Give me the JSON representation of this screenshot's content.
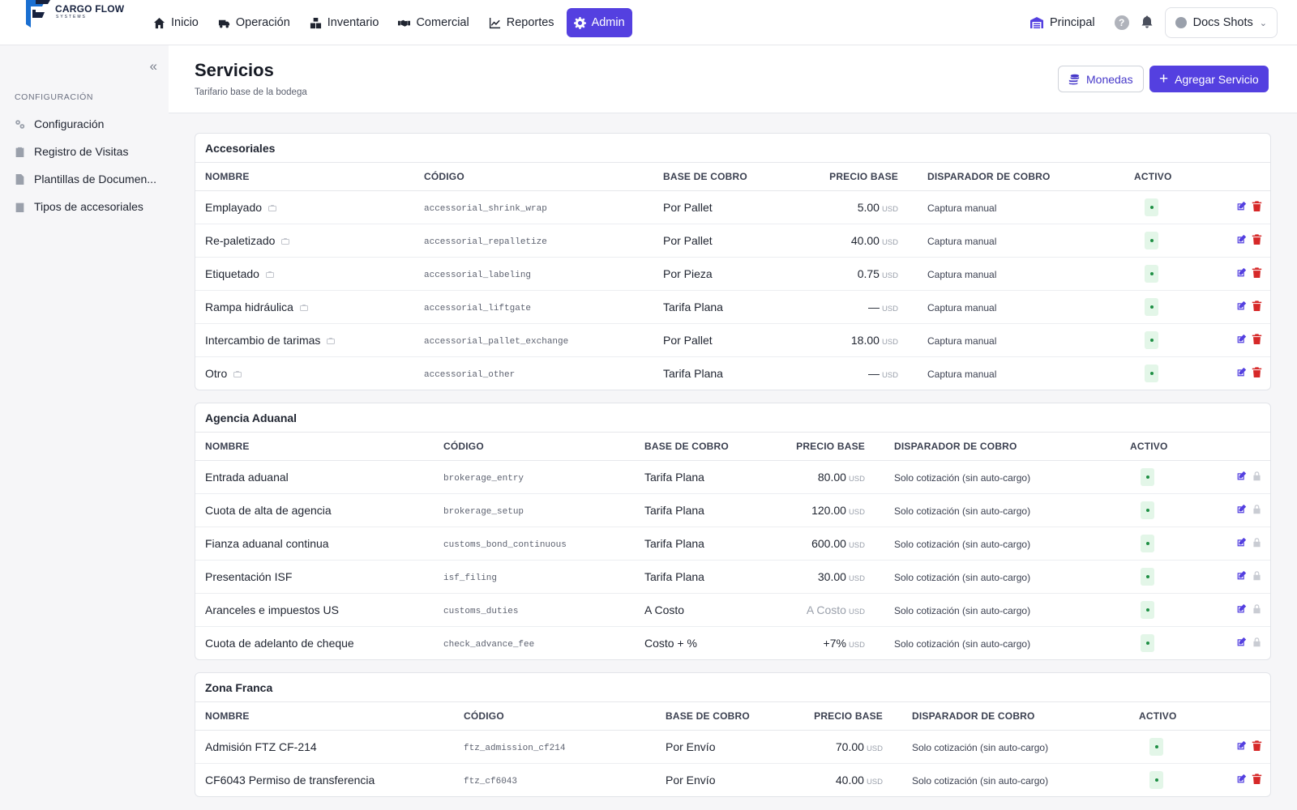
{
  "brand": {
    "name": "CARGO FLOW",
    "sub": "SYSTEMS"
  },
  "nav": [
    {
      "label": "Inicio",
      "icon": "home-icon",
      "active": false
    },
    {
      "label": "Operación",
      "icon": "truck-icon",
      "active": false
    },
    {
      "label": "Inventario",
      "icon": "boxes-icon",
      "active": false
    },
    {
      "label": "Comercial",
      "icon": "handshake-icon",
      "active": false
    },
    {
      "label": "Reportes",
      "icon": "chart-line-icon",
      "active": false
    },
    {
      "label": "Admin",
      "icon": "gear-icon",
      "active": true
    }
  ],
  "topbar": {
    "branch": "Principal",
    "help": "?",
    "user": "Docs Shots"
  },
  "sidebar": {
    "collapse_icon": "«",
    "heading": "CONFIGURACIÓN",
    "items": [
      {
        "label": "Configuración",
        "icon": "gears-icon"
      },
      {
        "label": "Registro de Visitas",
        "icon": "clipboard-icon"
      },
      {
        "label": "Plantillas de Documen...",
        "icon": "document-icon"
      },
      {
        "label": "Tipos de accesoriales",
        "icon": "tag-icon"
      }
    ]
  },
  "page": {
    "title": "Servicios",
    "subtitle": "Tarifario base de la bodega",
    "currencies_button": "Monedas",
    "add_button": "Agregar Servicio"
  },
  "columns": [
    "NOMBRE",
    "CÓDIGO",
    "BASE DE COBRO",
    "PRECIO BASE",
    "DISPARADOR DE COBRO",
    "ACTIVO"
  ],
  "colors": {
    "accent": "#5440e0",
    "delete": "#d62828",
    "active_bg": "#e3f6e8",
    "active_dot": "#1e8f44"
  },
  "sections": [
    {
      "title": "Accesoriales",
      "rows": [
        {
          "name": "Emplayado",
          "lock": true,
          "code": "accessorial_shrink_wrap",
          "base": "Por Pallet",
          "price": "5.00",
          "currency": "USD",
          "trigger": "Captura manual",
          "active": true,
          "deletable": true
        },
        {
          "name": "Re-paletizado",
          "lock": true,
          "code": "accessorial_repalletize",
          "base": "Por Pallet",
          "price": "40.00",
          "currency": "USD",
          "trigger": "Captura manual",
          "active": true,
          "deletable": true
        },
        {
          "name": "Etiquetado",
          "lock": true,
          "code": "accessorial_labeling",
          "base": "Por Pieza",
          "price": "0.75",
          "currency": "USD",
          "trigger": "Captura manual",
          "active": true,
          "deletable": true
        },
        {
          "name": "Rampa hidráulica",
          "lock": true,
          "code": "accessorial_liftgate",
          "base": "Tarifa Plana",
          "price": "—",
          "currency": "USD",
          "trigger": "Captura manual",
          "active": true,
          "deletable": true
        },
        {
          "name": "Intercambio de tarimas",
          "lock": true,
          "code": "accessorial_pallet_exchange",
          "base": "Por Pallet",
          "price": "18.00",
          "currency": "USD",
          "trigger": "Captura manual",
          "active": true,
          "deletable": true
        },
        {
          "name": "Otro",
          "lock": true,
          "code": "accessorial_other",
          "base": "Tarifa Plana",
          "price": "—",
          "currency": "USD",
          "trigger": "Captura manual",
          "active": true,
          "deletable": true
        }
      ]
    },
    {
      "title": "Agencia Aduanal",
      "rows": [
        {
          "name": "Entrada aduanal",
          "lock": false,
          "code": "brokerage_entry",
          "base": "Tarifa Plana",
          "price": "80.00",
          "currency": "USD",
          "trigger": "Solo cotización (sin auto-cargo)",
          "active": true,
          "deletable": false
        },
        {
          "name": "Cuota de alta de agencia",
          "lock": false,
          "code": "brokerage_setup",
          "base": "Tarifa Plana",
          "price": "120.00",
          "currency": "USD",
          "trigger": "Solo cotización (sin auto-cargo)",
          "active": true,
          "deletable": false
        },
        {
          "name": "Fianza aduanal continua",
          "lock": false,
          "code": "customs_bond_continuous",
          "base": "Tarifa Plana",
          "price": "600.00",
          "currency": "USD",
          "trigger": "Solo cotización (sin auto-cargo)",
          "active": true,
          "deletable": false
        },
        {
          "name": "Presentación ISF",
          "lock": false,
          "code": "isf_filing",
          "base": "Tarifa Plana",
          "price": "30.00",
          "currency": "USD",
          "trigger": "Solo cotización (sin auto-cargo)",
          "active": true,
          "deletable": false
        },
        {
          "name": "Aranceles e impuestos US",
          "lock": false,
          "code": "customs_duties",
          "base": "A Costo",
          "price": "A Costo",
          "price_muted": true,
          "currency": "USD",
          "trigger": "Solo cotización (sin auto-cargo)",
          "active": true,
          "deletable": false
        },
        {
          "name": "Cuota de adelanto de cheque",
          "lock": false,
          "code": "check_advance_fee",
          "base": "Costo + %",
          "price": "+7%",
          "currency": "USD",
          "trigger": "Solo cotización (sin auto-cargo)",
          "active": true,
          "deletable": false
        }
      ]
    },
    {
      "title": "Zona Franca",
      "rows": [
        {
          "name": "Admisión FTZ CF-214",
          "lock": false,
          "code": "ftz_admission_cf214",
          "base": "Por Envío",
          "price": "70.00",
          "currency": "USD",
          "trigger": "Solo cotización (sin auto-cargo)",
          "active": true,
          "deletable": true
        },
        {
          "name": "CF6043 Permiso de transferencia",
          "lock": false,
          "code": "ftz_cf6043",
          "base": "Por Envío",
          "price": "40.00",
          "currency": "USD",
          "trigger": "Solo cotización (sin auto-cargo)",
          "active": true,
          "deletable": true
        }
      ]
    }
  ]
}
